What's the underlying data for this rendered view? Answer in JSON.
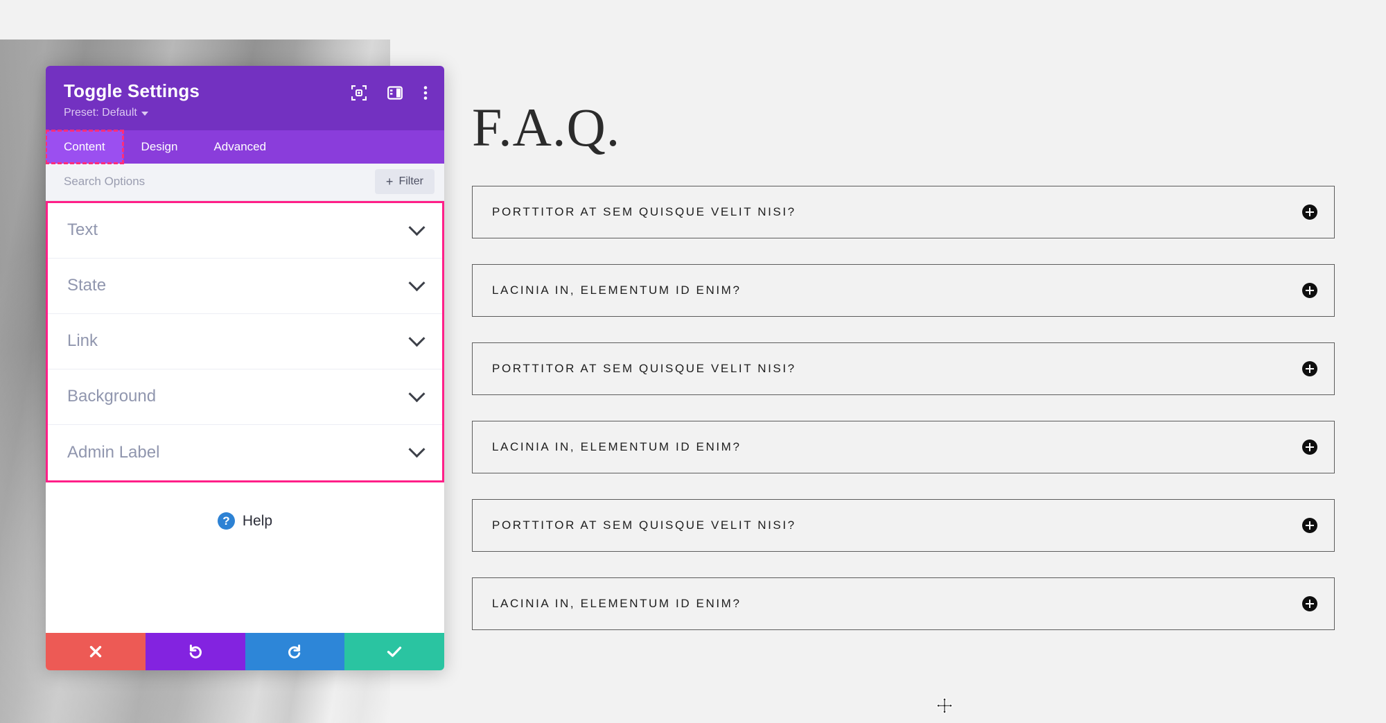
{
  "panel": {
    "title": "Toggle Settings",
    "preset": "Preset: Default",
    "header_icons": [
      {
        "name": "focus-target-icon"
      },
      {
        "name": "panel-layout-icon"
      },
      {
        "name": "more-vertical-icon"
      }
    ],
    "tabs": [
      {
        "label": "Content",
        "active": true
      },
      {
        "label": "Design",
        "active": false
      },
      {
        "label": "Advanced",
        "active": false
      }
    ],
    "search": {
      "placeholder": "Search Options",
      "value": ""
    },
    "filter_button": {
      "label": "Filter",
      "plus": "+"
    },
    "accordion": [
      {
        "label": "Text"
      },
      {
        "label": "State"
      },
      {
        "label": "Link"
      },
      {
        "label": "Background"
      },
      {
        "label": "Admin Label"
      }
    ],
    "help": {
      "label": "Help",
      "glyph": "?"
    },
    "actions": [
      {
        "name": "close-button",
        "glyph": "✖",
        "color": "#ed5a55"
      },
      {
        "name": "undo-button",
        "glyph": "↺",
        "color": "#8323e0"
      },
      {
        "name": "redo-button",
        "glyph": "↻",
        "color": "#2d86d8"
      },
      {
        "name": "save-button",
        "glyph": "✔",
        "color": "#2ac4a1"
      }
    ]
  },
  "content": {
    "faq_title": "F.A.Q.",
    "faq_items": [
      {
        "question": "PORTTITOR AT SEM QUISQUE VELIT NISI?",
        "icon": "plus-circle-icon"
      },
      {
        "question": "LACINIA IN, ELEMENTUM ID ENIM?",
        "icon": "plus-circle-icon"
      },
      {
        "question": "PORTTITOR AT SEM QUISQUE VELIT NISI?",
        "icon": "plus-circle-icon"
      },
      {
        "question": "LACINIA IN, ELEMENTUM ID ENIM?",
        "icon": "plus-circle-icon"
      },
      {
        "question": "PORTTITOR AT SEM QUISQUE VELIT NISI?",
        "icon": "plus-circle-icon"
      },
      {
        "question": "LACINIA IN, ELEMENTUM ID ENIM?",
        "icon": "plus-circle-icon"
      }
    ]
  },
  "colors": {
    "header_purple": "#7331c1",
    "tab_purple": "#8a3ddb",
    "tab_active_purple": "#9b4ff0",
    "highlight_pink": "#ff1f88",
    "dashed_pink": "#ff2d7a"
  },
  "cursor": {
    "type": "move-cursor"
  }
}
